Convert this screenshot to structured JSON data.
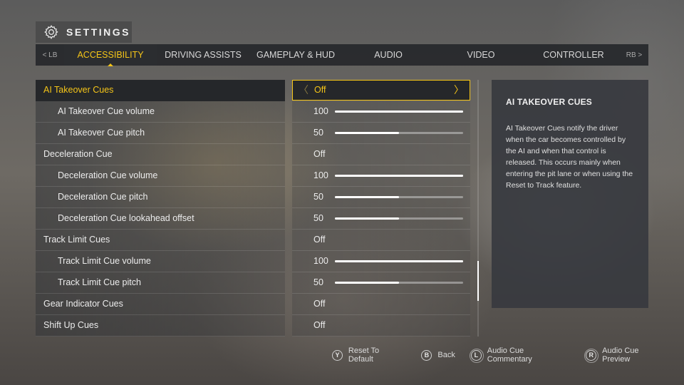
{
  "header": {
    "title": "SETTINGS",
    "icon": "gear-icon"
  },
  "tabbar": {
    "left_bumper": "< LB",
    "right_bumper": "RB >",
    "tabs": [
      {
        "label": "ACCESSIBILITY",
        "active": true
      },
      {
        "label": "DRIVING ASSISTS",
        "active": false
      },
      {
        "label": "GAMEPLAY & HUD",
        "active": false
      },
      {
        "label": "AUDIO",
        "active": false
      },
      {
        "label": "VIDEO",
        "active": false
      },
      {
        "label": "CONTROLLER",
        "active": false
      }
    ]
  },
  "settings": [
    {
      "label": "AI Takeover Cues",
      "value": "Off",
      "type": "toggle",
      "level": 0,
      "selected": true
    },
    {
      "label": "AI Takeover Cue volume",
      "value": "100",
      "type": "slider",
      "level": 1,
      "fraction": 1.0
    },
    {
      "label": "AI Takeover Cue pitch",
      "value": "50",
      "type": "slider",
      "level": 1,
      "fraction": 0.5
    },
    {
      "label": "Deceleration Cue",
      "value": "Off",
      "type": "toggle",
      "level": 0
    },
    {
      "label": "Deceleration Cue volume",
      "value": "100",
      "type": "slider",
      "level": 1,
      "fraction": 1.0
    },
    {
      "label": "Deceleration Cue pitch",
      "value": "50",
      "type": "slider",
      "level": 1,
      "fraction": 0.5
    },
    {
      "label": "Deceleration Cue lookahead offset",
      "value": "50",
      "type": "slider",
      "level": 1,
      "fraction": 0.5
    },
    {
      "label": "Track Limit Cues",
      "value": "Off",
      "type": "toggle",
      "level": 0
    },
    {
      "label": "Track Limit Cue volume",
      "value": "100",
      "type": "slider",
      "level": 1,
      "fraction": 1.0
    },
    {
      "label": "Track Limit Cue pitch",
      "value": "50",
      "type": "slider",
      "level": 1,
      "fraction": 0.5
    },
    {
      "label": "Gear Indicator Cues",
      "value": "Off",
      "type": "toggle",
      "level": 0
    },
    {
      "label": "Shift Up Cues",
      "value": "Off",
      "type": "toggle",
      "level": 0
    }
  ],
  "selector_arrows": {
    "left": "〈",
    "right": "〉"
  },
  "info": {
    "title": "AI TAKEOVER CUES",
    "body": "AI Takeover Cues notify the driver when the car becomes controlled by the AI and when that control is released. This occurs mainly when entering the pit lane or when using the Reset to Track feature."
  },
  "footer": [
    {
      "glyph": "Y",
      "label": "Reset To Default",
      "icon": "y-button-icon"
    },
    {
      "glyph": "B",
      "label": "Back",
      "icon": "b-button-icon"
    },
    {
      "glyph": "L",
      "label": "Audio Cue Commentary",
      "icon": "left-stick-icon"
    },
    {
      "glyph": "R",
      "label": "Audio Cue Preview",
      "icon": "right-stick-icon"
    }
  ],
  "colors": {
    "accent": "#f5c518"
  }
}
